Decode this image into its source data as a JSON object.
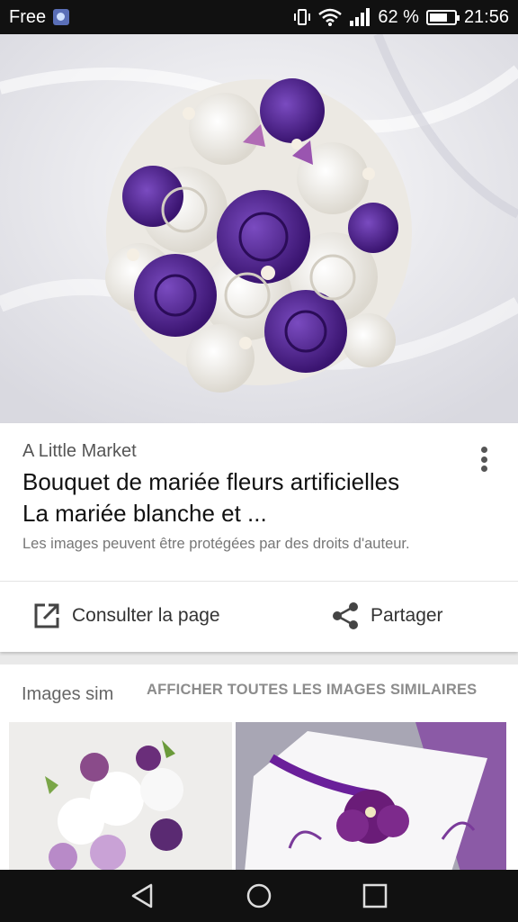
{
  "status_bar": {
    "carrier": "Free",
    "battery": "62 %",
    "time": "21:56"
  },
  "result": {
    "source": "A Little Market",
    "title_line1": "Bouquet de mariée fleurs artificielles",
    "title_line2": "La mariée blanche et ...",
    "copyright_notice": "Les images peuvent être protégées par des droits d'auteur.",
    "visit_label": "Consulter la page",
    "share_label": "Partager"
  },
  "similar": {
    "title": "Images sim",
    "see_all": "AFFICHER TOUTES LES IMAGES SIMILAIRES"
  },
  "colors": {
    "purple": "#4b1d82",
    "white_rose": "#f6f4ef",
    "status_bg": "#111111"
  },
  "icons": [
    "carrier-icon",
    "vibrate-icon",
    "wifi-icon",
    "signal-icon",
    "battery-icon",
    "more-vert-icon",
    "open-in-new-icon",
    "share-icon",
    "back-icon",
    "home-icon",
    "recents-icon"
  ]
}
